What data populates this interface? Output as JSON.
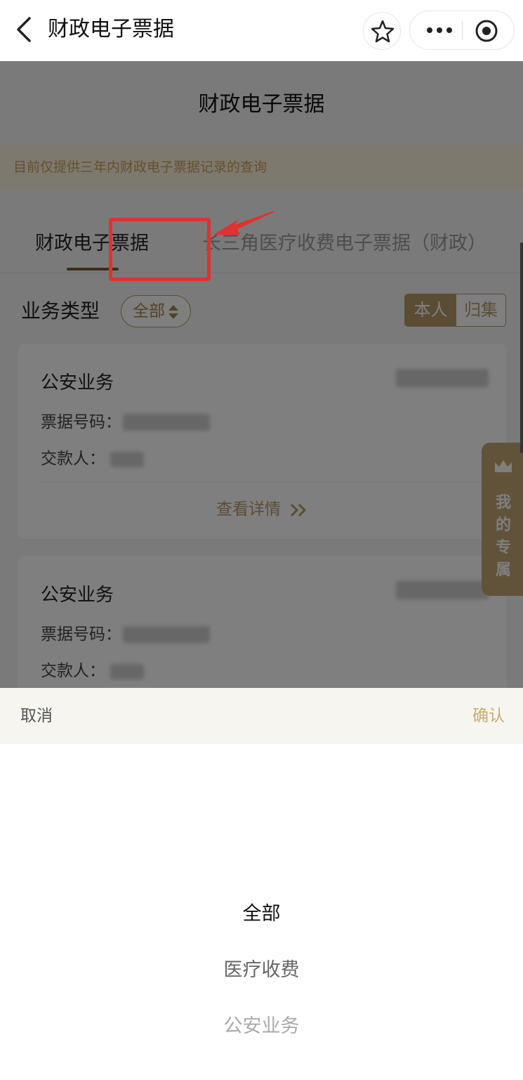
{
  "navbar": {
    "title": "财政电子票据",
    "icons": {
      "back": "back-arrow-icon",
      "favorite": "star-icon",
      "more": "more-dots-icon",
      "close": "target-circle-icon"
    }
  },
  "page": {
    "title": "财政电子票据",
    "notice": "目前仅提供三年内财政电子票据记录的查询",
    "tabs": [
      {
        "label": "财政电子票据",
        "active": true
      },
      {
        "label": "长三角医疗收费电子票据（财政）",
        "active": false
      }
    ],
    "filter": {
      "label": "业务类型",
      "selected": "全部"
    },
    "scope_toggle": {
      "options": [
        "本人",
        "归集"
      ],
      "active": "本人"
    },
    "cards": [
      {
        "title": "公安业务",
        "bill_label": "票据号码：",
        "payer_label": "交款人：",
        "detail_label": "查看详情"
      },
      {
        "title": "公安业务",
        "bill_label": "票据号码：",
        "payer_label": "交款人："
      }
    ],
    "side_float": {
      "label": "我的专属"
    }
  },
  "colors": {
    "accent": "#b69a66",
    "highlight": "#e33030",
    "notice_bg": "#fdf2dc",
    "confirm": "#c8ab70"
  },
  "picker": {
    "cancel": "取消",
    "confirm": "确认",
    "options": [
      "全部",
      "医疗收费",
      "公安业务"
    ],
    "selected": "全部"
  }
}
